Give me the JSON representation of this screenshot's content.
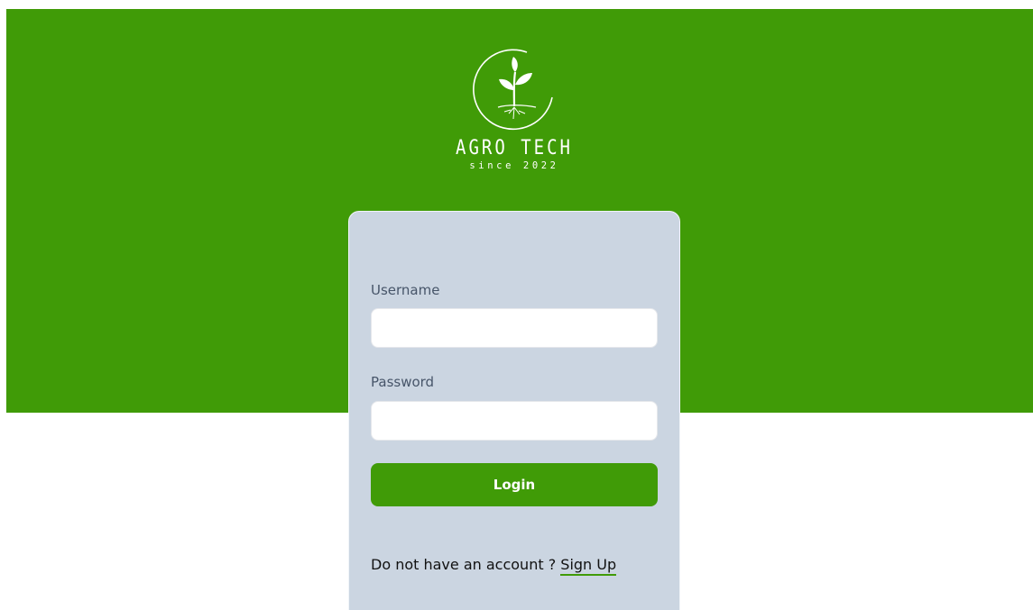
{
  "brand": {
    "name": "AGRO TECH",
    "since": "since 2022",
    "logo_icon": "sprout-in-circle-icon"
  },
  "colors": {
    "primary_green": "#409b07",
    "card_background": "#cbd5e1",
    "page_background": "#ffffff"
  },
  "login_form": {
    "username_label": "Username",
    "username_value": "",
    "password_label": "Password",
    "password_value": "",
    "login_label": "Login",
    "signup_prompt": "Do not have an account ?",
    "signup_link": "Sign Up"
  }
}
